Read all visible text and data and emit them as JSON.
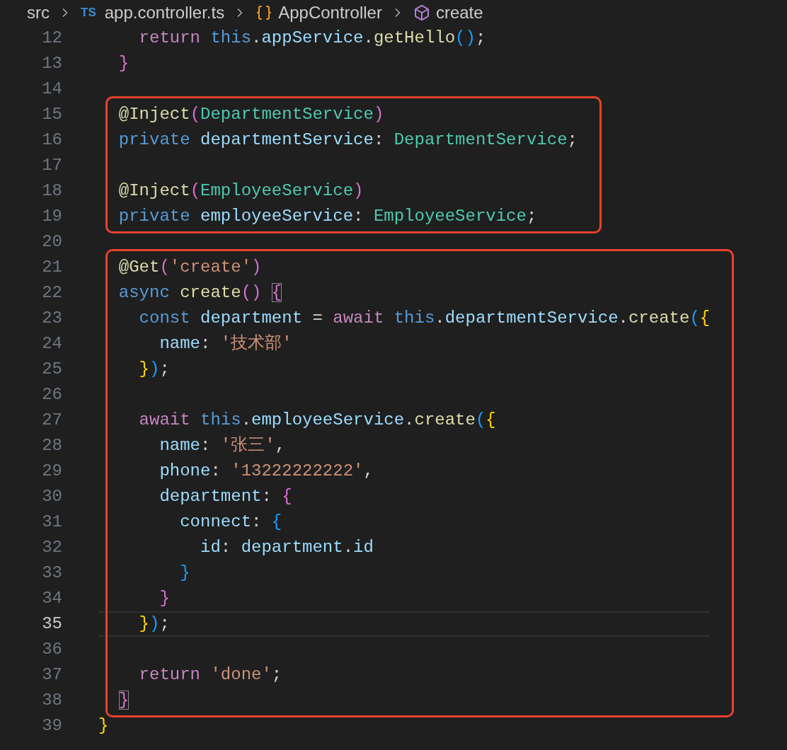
{
  "breadcrumb": [
    {
      "kind": "folder",
      "label": "src"
    },
    {
      "kind": "file",
      "badge": "TS",
      "label": "app.controller.ts"
    },
    {
      "kind": "class",
      "label": "AppController"
    },
    {
      "kind": "method",
      "label": "create"
    }
  ],
  "blocks": [
    {
      "framed": false,
      "lines": [
        {
          "number": "12",
          "current": false,
          "tokens": [
            {
              "kind": "control",
              "text": "    return "
            },
            {
              "kind": "keyword",
              "text": "this"
            },
            {
              "kind": "plain",
              "text": "."
            },
            {
              "kind": "variable",
              "text": "appService"
            },
            {
              "kind": "plain",
              "text": "."
            },
            {
              "kind": "function",
              "text": "getHello"
            },
            {
              "kind": "bracket3",
              "text": "()"
            },
            {
              "kind": "plain",
              "text": ";"
            }
          ]
        },
        {
          "number": "13",
          "current": false,
          "tokens": [
            {
              "kind": "bracket2",
              "text": "  }"
            }
          ]
        },
        {
          "number": "14",
          "current": false
        }
      ]
    },
    {
      "framed": true,
      "lines": [
        {
          "number": "15",
          "current": false,
          "tokens": [
            {
              "kind": "function",
              "text": "  @Inject"
            },
            {
              "kind": "bracket2",
              "text": "("
            },
            {
              "kind": "type",
              "text": "DepartmentService"
            },
            {
              "kind": "bracket2",
              "text": ")"
            }
          ]
        },
        {
          "number": "16",
          "current": false,
          "tokens": [
            {
              "kind": "keyword",
              "text": "  private "
            },
            {
              "kind": "variable",
              "text": "departmentService"
            },
            {
              "kind": "plain",
              "text": ": "
            },
            {
              "kind": "type",
              "text": "DepartmentService"
            },
            {
              "kind": "plain",
              "text": ";"
            }
          ]
        },
        {
          "number": "17",
          "current": false
        },
        {
          "number": "18",
          "current": false,
          "tokens": [
            {
              "kind": "function",
              "text": "  @Inject"
            },
            {
              "kind": "bracket2",
              "text": "("
            },
            {
              "kind": "type",
              "text": "EmployeeService"
            },
            {
              "kind": "bracket2",
              "text": ")"
            }
          ]
        },
        {
          "number": "19",
          "current": false,
          "tokens": [
            {
              "kind": "keyword",
              "text": "  private "
            },
            {
              "kind": "variable",
              "text": "employeeService"
            },
            {
              "kind": "plain",
              "text": ": "
            },
            {
              "kind": "type",
              "text": "EmployeeService"
            },
            {
              "kind": "plain",
              "text": ";"
            }
          ]
        }
      ]
    },
    {
      "framed": false,
      "lines": [
        {
          "number": "20",
          "current": false
        }
      ]
    },
    {
      "framed": true,
      "lines": [
        {
          "number": "21",
          "current": false,
          "tokens": [
            {
              "kind": "function",
              "text": "  @Get"
            },
            {
              "kind": "bracket2",
              "text": "("
            },
            {
              "kind": "string",
              "text": "'create'"
            },
            {
              "kind": "bracket2",
              "text": ")"
            }
          ]
        },
        {
          "number": "22",
          "current": false,
          "tokens": [
            {
              "kind": "keyword",
              "text": "  async "
            },
            {
              "kind": "function",
              "text": "create"
            },
            {
              "kind": "bracket2",
              "text": "() "
            },
            {
              "kind": "bracket2_match",
              "text": "{"
            }
          ]
        },
        {
          "number": "23",
          "current": false,
          "tokens": [
            {
              "kind": "keyword",
              "text": "    const "
            },
            {
              "kind": "variable",
              "text": "department"
            },
            {
              "kind": "plain",
              "text": " = "
            },
            {
              "kind": "control",
              "text": "await "
            },
            {
              "kind": "keyword",
              "text": "this"
            },
            {
              "kind": "plain",
              "text": "."
            },
            {
              "kind": "variable",
              "text": "departmentService"
            },
            {
              "kind": "plain",
              "text": "."
            },
            {
              "kind": "function",
              "text": "create"
            },
            {
              "kind": "bracket3",
              "text": "("
            },
            {
              "kind": "bracket1",
              "text": "{"
            }
          ]
        },
        {
          "number": "24",
          "current": false,
          "tokens": [
            {
              "kind": "variable",
              "text": "      name"
            },
            {
              "kind": "plain",
              "text": ": "
            },
            {
              "kind": "string",
              "text": "'技术部'"
            }
          ]
        },
        {
          "number": "25",
          "current": false,
          "tokens": [
            {
              "kind": "bracket1",
              "text": "    }"
            },
            {
              "kind": "bracket3",
              "text": ")"
            },
            {
              "kind": "plain",
              "text": ";"
            }
          ]
        },
        {
          "number": "26",
          "current": false
        },
        {
          "number": "27",
          "current": false,
          "tokens": [
            {
              "kind": "control",
              "text": "    await "
            },
            {
              "kind": "keyword",
              "text": "this"
            },
            {
              "kind": "plain",
              "text": "."
            },
            {
              "kind": "variable",
              "text": "employeeService"
            },
            {
              "kind": "plain",
              "text": "."
            },
            {
              "kind": "function",
              "text": "create"
            },
            {
              "kind": "bracket3",
              "text": "("
            },
            {
              "kind": "bracket1",
              "text": "{"
            }
          ]
        },
        {
          "number": "28",
          "current": false,
          "tokens": [
            {
              "kind": "variable",
              "text": "      name"
            },
            {
              "kind": "plain",
              "text": ": "
            },
            {
              "kind": "string",
              "text": "'张三'"
            },
            {
              "kind": "plain",
              "text": ","
            }
          ]
        },
        {
          "number": "29",
          "current": false,
          "tokens": [
            {
              "kind": "variable",
              "text": "      phone"
            },
            {
              "kind": "plain",
              "text": ": "
            },
            {
              "kind": "string",
              "text": "'13222222222'"
            },
            {
              "kind": "plain",
              "text": ","
            }
          ]
        },
        {
          "number": "30",
          "current": false,
          "tokens": [
            {
              "kind": "variable",
              "text": "      department"
            },
            {
              "kind": "plain",
              "text": ": "
            },
            {
              "kind": "bracket2",
              "text": "{"
            }
          ]
        },
        {
          "number": "31",
          "current": false,
          "tokens": [
            {
              "kind": "variable",
              "text": "        connect"
            },
            {
              "kind": "plain",
              "text": ": "
            },
            {
              "kind": "bracket3",
              "text": "{"
            }
          ]
        },
        {
          "number": "32",
          "current": false,
          "tokens": [
            {
              "kind": "variable",
              "text": "          id"
            },
            {
              "kind": "plain",
              "text": ": "
            },
            {
              "kind": "variable",
              "text": "department"
            },
            {
              "kind": "plain",
              "text": "."
            },
            {
              "kind": "variable",
              "text": "id"
            }
          ]
        },
        {
          "number": "33",
          "current": false,
          "tokens": [
            {
              "kind": "bracket3",
              "text": "        }"
            }
          ]
        },
        {
          "number": "34",
          "current": false,
          "tokens": [
            {
              "kind": "bracket2",
              "text": "      }"
            }
          ]
        },
        {
          "number": "35",
          "current": true,
          "tokens": [
            {
              "kind": "bracket1",
              "text": "    }"
            },
            {
              "kind": "bracket3",
              "text": ")"
            },
            {
              "kind": "plain",
              "text": ";"
            }
          ]
        },
        {
          "number": "36",
          "current": false
        },
        {
          "number": "37",
          "current": false,
          "tokens": [
            {
              "kind": "control",
              "text": "    return "
            },
            {
              "kind": "string",
              "text": "'done'"
            },
            {
              "kind": "plain",
              "text": ";"
            }
          ]
        },
        {
          "number": "38",
          "current": false,
          "tokens": [
            {
              "kind": "bracket2_match",
              "text": "  }"
            }
          ]
        }
      ]
    },
    {
      "framed": false,
      "lines": [
        {
          "number": "39",
          "current": false,
          "tokens": [
            {
              "kind": "bracket1",
              "text": "}"
            }
          ]
        }
      ]
    }
  ]
}
